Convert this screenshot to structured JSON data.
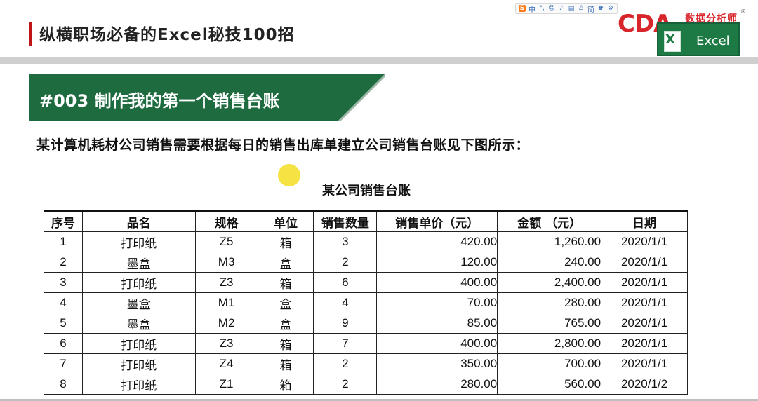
{
  "header": {
    "title": "纵横职场必备的Excel秘技100招"
  },
  "toolbar": {
    "items": [
      "中",
      "简"
    ]
  },
  "logo": {
    "brand": "CDA",
    "chinese": "数据分析师",
    "product": "Excel",
    "registered": "®"
  },
  "banner": {
    "title": "#003 制作我的第一个销售台账"
  },
  "intro": "某计算机耗材公司销售需要根据每日的销售出库单建立公司销售台账见下图所示：",
  "ledger": {
    "title": "某公司销售台账",
    "columns": [
      "序号",
      "品名",
      "规格",
      "单位",
      "销售数量",
      "销售单价（元）",
      "金额 （元）",
      "日期"
    ],
    "rows": [
      [
        "1",
        "打印纸",
        "Z5",
        "箱",
        "3",
        "420.00",
        "1,260.00",
        "2020/1/1"
      ],
      [
        "2",
        "墨盒",
        "M3",
        "盒",
        "2",
        "120.00",
        "240.00",
        "2020/1/1"
      ],
      [
        "3",
        "打印纸",
        "Z3",
        "箱",
        "6",
        "400.00",
        "2,400.00",
        "2020/1/1"
      ],
      [
        "4",
        "墨盒",
        "M1",
        "盒",
        "4",
        "70.00",
        "280.00",
        "2020/1/1"
      ],
      [
        "5",
        "墨盒",
        "M2",
        "盒",
        "9",
        "85.00",
        "765.00",
        "2020/1/1"
      ],
      [
        "6",
        "打印纸",
        "Z3",
        "箱",
        "7",
        "400.00",
        "2,800.00",
        "2020/1/1"
      ],
      [
        "7",
        "打印纸",
        "Z4",
        "箱",
        "2",
        "350.00",
        "700.00",
        "2020/1/1"
      ],
      [
        "8",
        "打印纸",
        "Z1",
        "箱",
        "2",
        "280.00",
        "560.00",
        "2020/1/2"
      ]
    ]
  },
  "colors": {
    "banner_green": "#1e6b3f",
    "accent_red": "#c0141b",
    "cursor_highlight": "#f4e23a"
  }
}
